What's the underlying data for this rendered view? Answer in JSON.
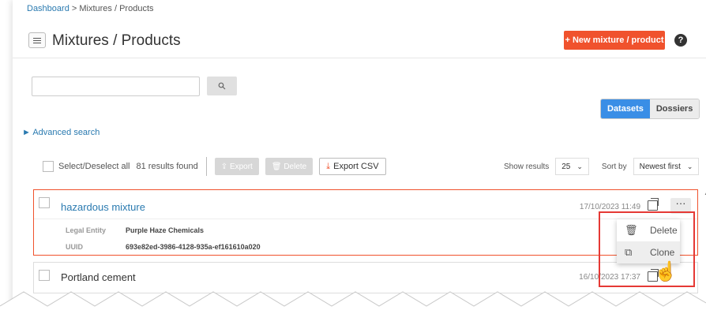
{
  "breadcrumb": {
    "dashboard": "Dashboard",
    "rest": " > Mixtures / Products"
  },
  "header": {
    "title": "Mixtures / Products",
    "new_button": "+ New mixture / product",
    "help": "?"
  },
  "search": {
    "placeholder": "",
    "button_icon": "search-icon"
  },
  "view_toggle": {
    "datasets": "Datasets",
    "dossiers": "Dossiers",
    "active": "Datasets"
  },
  "advanced_search": "► Advanced search",
  "toolbar": {
    "select_all": "Select/Deselect all",
    "results": "81 results found",
    "export": "⇪ Export",
    "delete": "🗑 Delete",
    "export_csv": "Export CSV",
    "show_results_label": "Show results",
    "show_results_value": "25",
    "sort_label": "Sort by",
    "sort_value": "Newest first"
  },
  "items": [
    {
      "title": "hazardous mixture",
      "date": "17/10/2023 11:49",
      "legal_entity_label": "Legal Entity",
      "legal_entity": "Purple Haze Chemicals",
      "uuid_label": "UUID",
      "uuid": "693e82ed-3986-4128-935a-ef161610a020"
    },
    {
      "title": "Portland cement",
      "date": "16/10/2023 17:37"
    }
  ],
  "context_menu": {
    "delete": "Delete",
    "clone": "Clone"
  },
  "colors": {
    "accent": "#f0522d",
    "link": "#2a7ab0",
    "toggle_active": "#3a8ee6",
    "highlight": "#e53935"
  }
}
